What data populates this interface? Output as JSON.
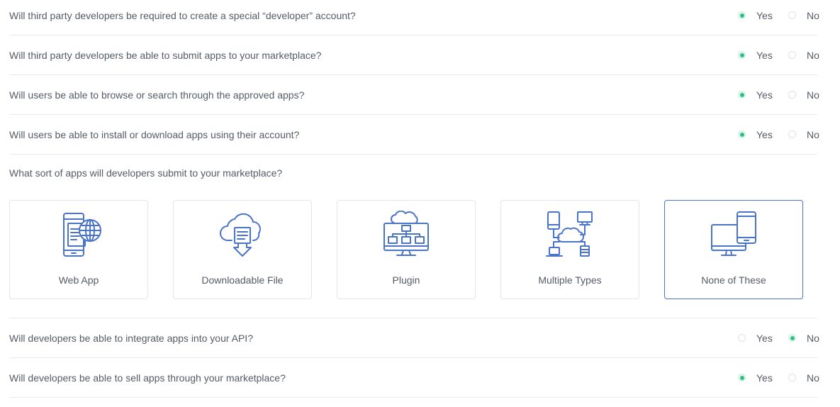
{
  "questions_top": [
    {
      "text": "Will third party developers be required to create a special “developer” account?",
      "yes": "Yes",
      "no": "No",
      "selected": "yes"
    },
    {
      "text": "Will third party developers be able to submit apps to your marketplace?",
      "yes": "Yes",
      "no": "No",
      "selected": "yes"
    },
    {
      "text": "Will users be able to browse or search through the approved apps?",
      "yes": "Yes",
      "no": "No",
      "selected": "yes"
    },
    {
      "text": "Will users be able to install or download apps using their account?",
      "yes": "Yes",
      "no": "No",
      "selected": "yes"
    }
  ],
  "app_types": {
    "title": "What sort of apps will developers submit to your marketplace?",
    "cards": [
      {
        "label": "Web App",
        "icon": "web-app-icon",
        "selected": false
      },
      {
        "label": "Downloadable File",
        "icon": "cloud-download-icon",
        "selected": false
      },
      {
        "label": "Plugin",
        "icon": "plugin-network-icon",
        "selected": false
      },
      {
        "label": "Multiple Types",
        "icon": "multiple-devices-icon",
        "selected": false
      },
      {
        "label": "None of These",
        "icon": "monitor-phone-icon",
        "selected": true
      }
    ]
  },
  "questions_bottom": [
    {
      "text": "Will developers be able to integrate apps into your API?",
      "yes": "Yes",
      "no": "No",
      "selected": "no"
    },
    {
      "text": "Will developers be able to sell apps through your marketplace?",
      "yes": "Yes",
      "no": "No",
      "selected": "yes"
    }
  ],
  "colors": {
    "accent_green": "#2fbf85",
    "icon_blue": "#4a74c9",
    "text": "#555b66",
    "divider": "#e8eaed"
  }
}
